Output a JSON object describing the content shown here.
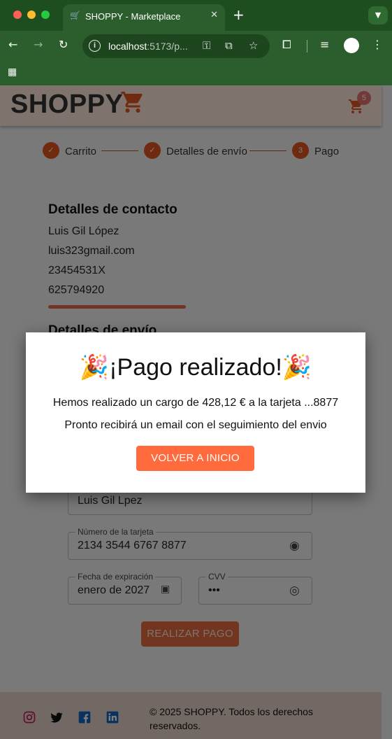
{
  "browser": {
    "tab_title": "SHOPPY - Marketplace",
    "url_host": "localhost",
    "url_path": ":5173/p..."
  },
  "header": {
    "logo_text": "SHOPPY",
    "cart_count": "5"
  },
  "stepper": {
    "steps": [
      {
        "label": "Carrito",
        "state": "done"
      },
      {
        "label": "Detalles de envío",
        "state": "done"
      },
      {
        "label": "Pago",
        "number": "3",
        "state": "active"
      }
    ]
  },
  "contact": {
    "title": "Detalles de contacto",
    "name": "Luis Gil López",
    "email": "luis323gmail.com",
    "id_number": "23454531X",
    "phone": "625794920"
  },
  "shipping": {
    "title": "Detalles de envío"
  },
  "payment": {
    "cardholder_value": "Luis Gil Lpez",
    "card_number_label": "Número de la tarjeta",
    "card_number_value": "2134 3544 6767 8877",
    "expiry_label": "Fecha de expiración",
    "expiry_value": "enero de 2027",
    "cvv_label": "CVV",
    "cvv_value": "•••",
    "pay_button": "REALIZAR PAGO"
  },
  "dialog": {
    "title": "🎉¡Pago realizado!🎉",
    "charge_message": "Hemos realizado un cargo de 428,12 € a la tarjeta ...8877",
    "email_message": "Pronto recibirá un email con el seguimiento del envio",
    "button": "VOLVER A INICIO"
  },
  "footer": {
    "copyright": "© 2025 SHOPPY. Todos los derechos reservados."
  },
  "colors": {
    "accent": "#e0551f",
    "primary_button": "#ff6b3d",
    "chrome_green": "#2b5e2c"
  }
}
